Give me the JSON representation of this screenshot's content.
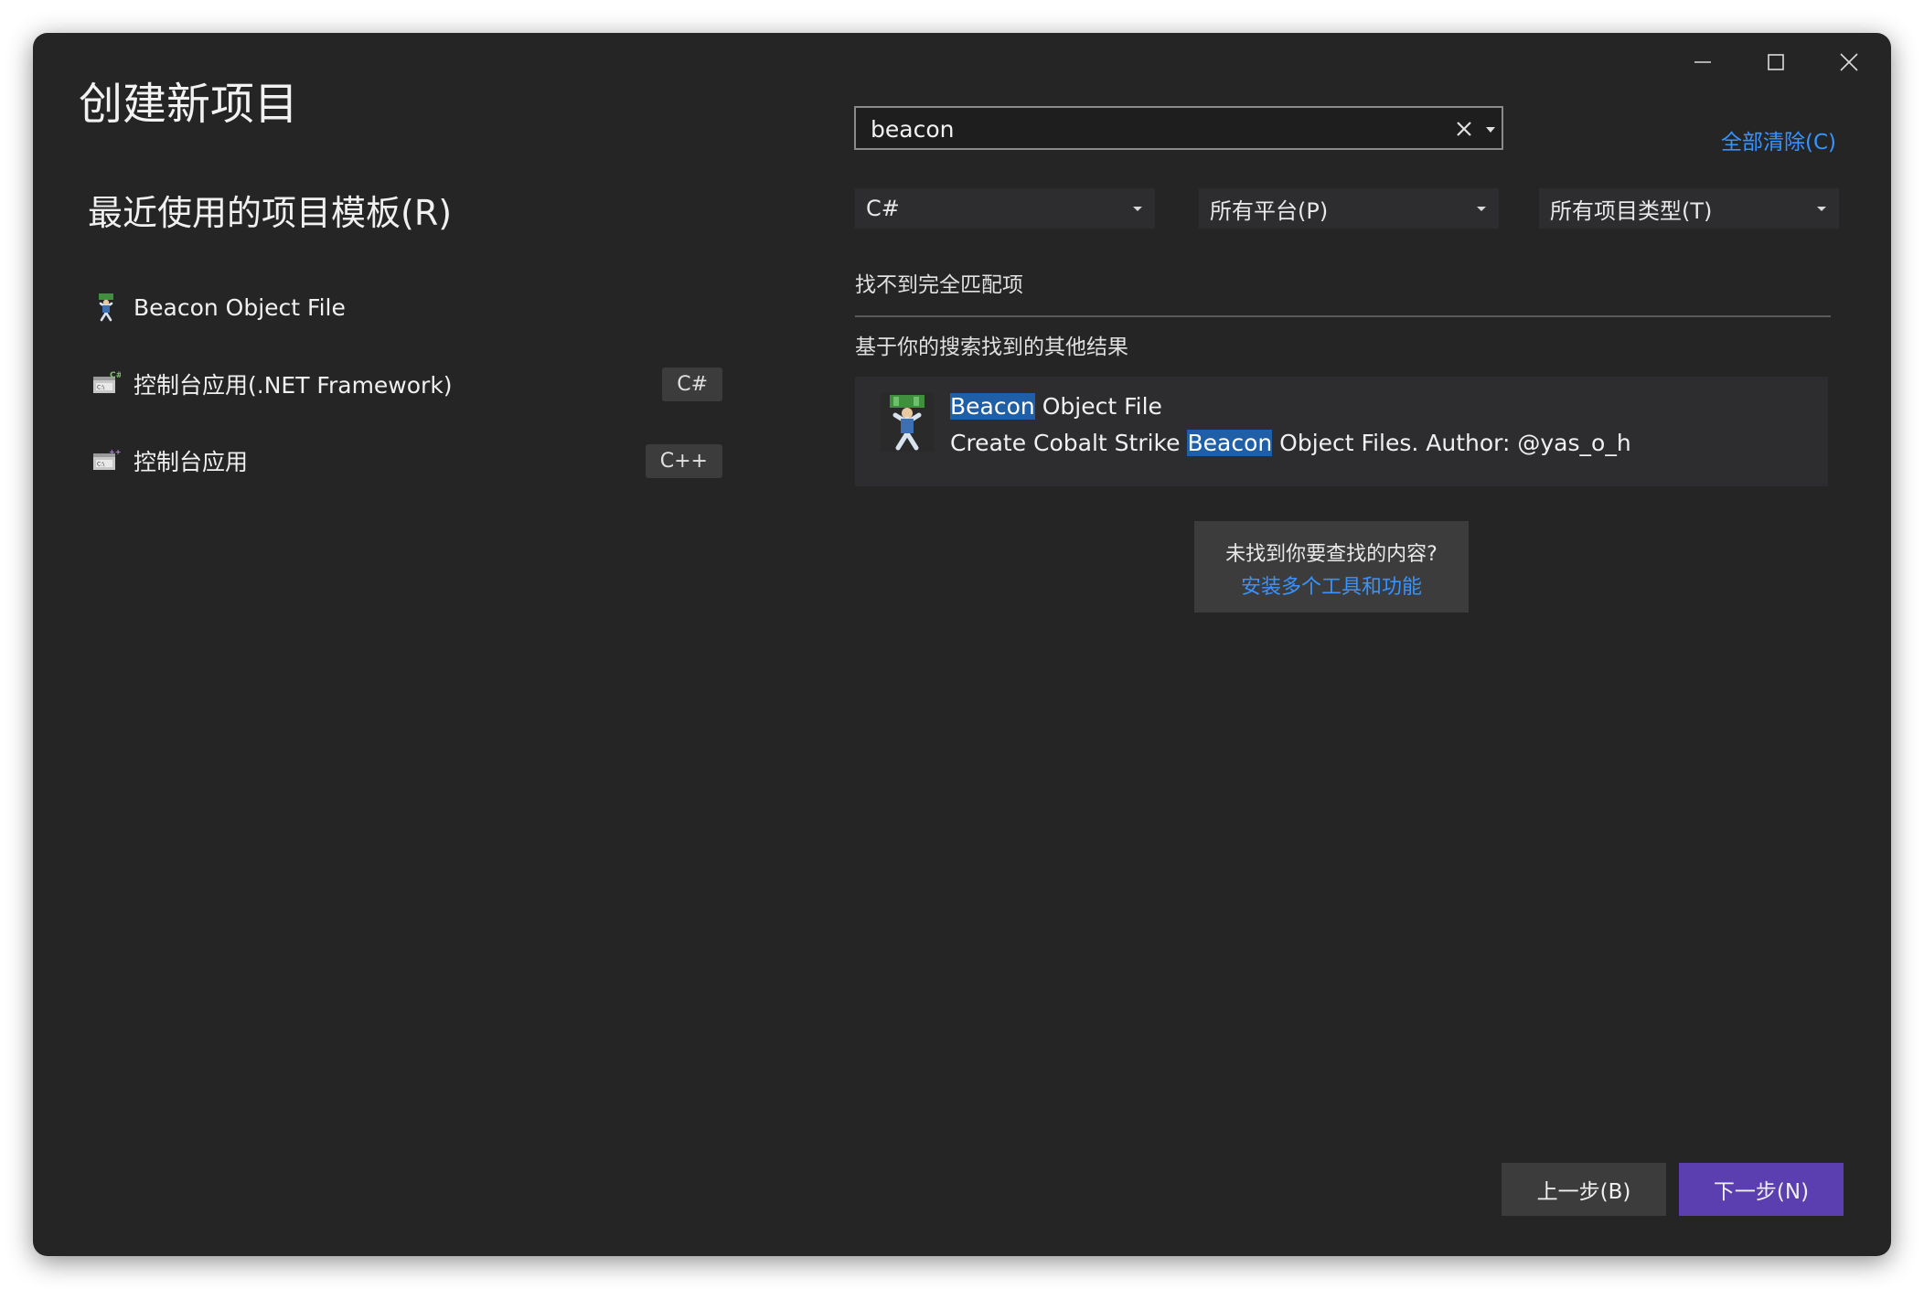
{
  "window": {
    "title": "创建新项目",
    "controls": {
      "minimize_icon": "minimize-icon",
      "maximize_icon": "maximize-icon",
      "close_icon": "close-icon"
    }
  },
  "recent": {
    "heading": "最近使用的项目模板(R)",
    "items": [
      {
        "label": "Beacon Object File",
        "tag": "",
        "icon": "beacon-template-icon"
      },
      {
        "label": "控制台应用(.NET Framework)",
        "tag": "C#",
        "icon": "console-app-icon"
      },
      {
        "label": "控制台应用",
        "tag": "C++",
        "icon": "console-app-icon"
      }
    ]
  },
  "search": {
    "value": "beacon",
    "placeholder": "",
    "clear_all": "全部清除(C)"
  },
  "filters": {
    "language": "C#",
    "platform": "所有平台(P)",
    "project_type": "所有项目类型(T)"
  },
  "results": {
    "no_exact_match": "找不到完全匹配项",
    "other_results_heading": "基于你的搜索找到的其他结果",
    "items": [
      {
        "title_highlight": "Beacon",
        "title_rest": " Object File",
        "desc_before": "Create Cobalt Strike ",
        "desc_highlight": "Beacon",
        "desc_after": " Object Files. Author: @yas_o_h"
      }
    ]
  },
  "missing": {
    "question": "未找到你要查找的内容?",
    "link": "安装多个工具和功能"
  },
  "buttons": {
    "back": "上一步(B)",
    "next": "下一步(N)"
  },
  "colors": {
    "window_bg": "#252526",
    "accent_link": "#3794ff",
    "primary_button": "#5b3fb0",
    "highlight": "#1f5fa8"
  }
}
